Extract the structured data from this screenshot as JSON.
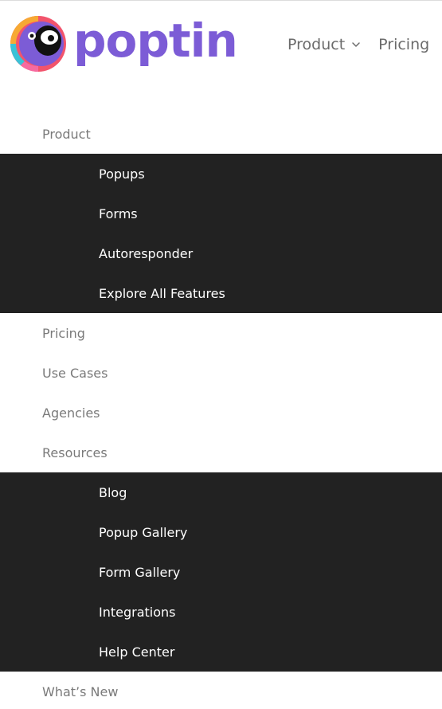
{
  "brand": {
    "name": "poptin",
    "color": "#7c5cd6"
  },
  "header": {
    "nav": [
      {
        "label": "Product",
        "has_dropdown": true
      },
      {
        "label": "Pricing",
        "has_dropdown": false
      }
    ]
  },
  "menu": {
    "product": {
      "label": "Product",
      "children": [
        {
          "label": "Popups"
        },
        {
          "label": "Forms"
        },
        {
          "label": "Autoresponder"
        },
        {
          "label": "Explore All Features"
        }
      ]
    },
    "pricing": {
      "label": "Pricing"
    },
    "use_cases": {
      "label": "Use Cases"
    },
    "agencies": {
      "label": "Agencies"
    },
    "resources": {
      "label": "Resources",
      "children": [
        {
          "label": "Blog"
        },
        {
          "label": "Popup Gallery"
        },
        {
          "label": "Form Gallery"
        },
        {
          "label": "Integrations"
        },
        {
          "label": "Help Center"
        }
      ]
    },
    "whats_new": {
      "label": "What’s New"
    }
  },
  "colors": {
    "submenu_bg": "#222222",
    "top_level_text": "#7a7a7a",
    "submenu_text": "#ffffff"
  },
  "icons": {
    "logo": "poptin-parrot-logo",
    "dropdown": "chevron-down-icon"
  }
}
